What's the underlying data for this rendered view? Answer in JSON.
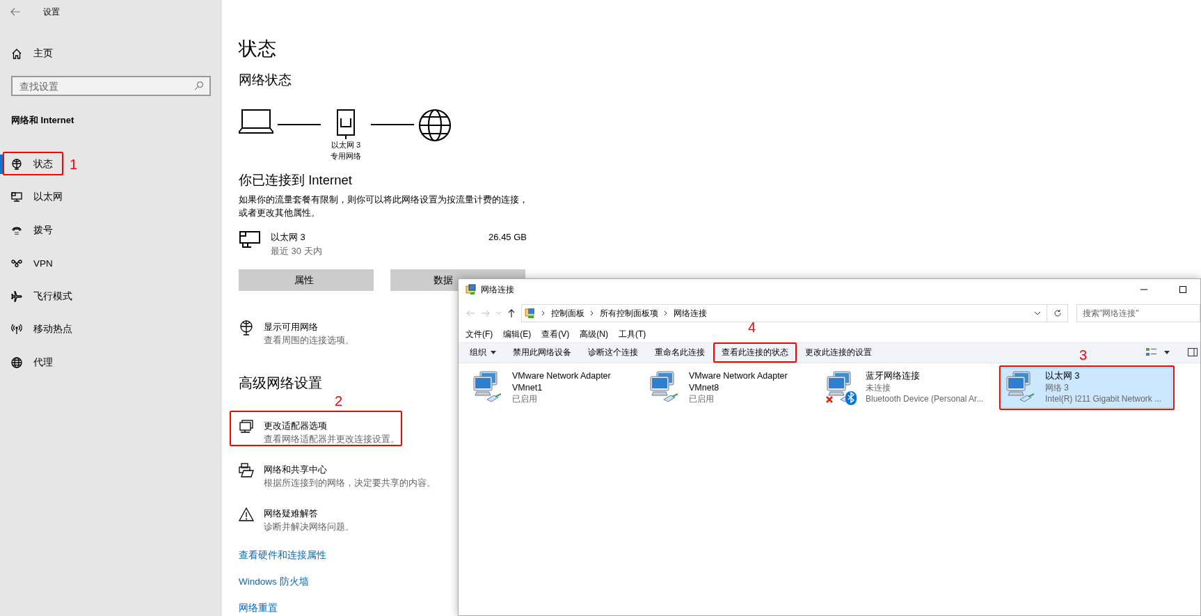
{
  "settings": {
    "title": "设置",
    "home": "主页",
    "search": {
      "placeholder": "查找设置"
    },
    "section": "网络和 Internet",
    "nav": [
      {
        "label": "状态",
        "selected": true,
        "annotation": "1"
      },
      {
        "label": "以太网",
        "selected": false
      },
      {
        "label": "拨号",
        "selected": false
      },
      {
        "label": "VPN",
        "selected": false
      },
      {
        "label": "飞行模式",
        "selected": false
      },
      {
        "label": "移动热点",
        "selected": false
      },
      {
        "label": "代理",
        "selected": false
      }
    ]
  },
  "page": {
    "title": "状态",
    "subtitle": "网络状态",
    "diagram": {
      "adapter": "以太网 3",
      "network": "专用网络"
    },
    "connected": "你已连接到 Internet",
    "description": "如果你的流量套餐有限制，则你可以将此网络设置为按流量计费的连接，或者更改其他属性。",
    "usage": {
      "name": "以太网 3",
      "period": "最近 30 天内",
      "amount": "26.45 GB"
    },
    "buttons": [
      "属性",
      "数据"
    ],
    "show_networks": {
      "title": "显示可用网络",
      "subtitle": "查看周围的连接选项。"
    },
    "advanced_heading": "高级网络设置",
    "options": [
      {
        "title": "更改适配器选项",
        "subtitle": "查看网络适配器并更改连接设置。",
        "annotation": "2"
      },
      {
        "title": "网络和共享中心",
        "subtitle": "根据所连接到的网络，决定要共享的内容。"
      },
      {
        "title": "网络疑难解答",
        "subtitle": "诊断并解决网络问题。"
      }
    ],
    "links": [
      "查看硬件和连接属性",
      "Windows 防火墙",
      "网络重置"
    ]
  },
  "explorer": {
    "title": "网络连接",
    "breadcrumbs": [
      "控制面板",
      "所有控制面板项",
      "网络连接"
    ],
    "search": {
      "placeholder": "搜索\"网络连接\""
    },
    "menu": [
      "文件(F)",
      "编辑(E)",
      "查看(V)",
      "高级(N)",
      "工具(T)"
    ],
    "commands": [
      {
        "label": "组织",
        "dropdown": true
      },
      {
        "label": "禁用此网络设备",
        "dropdown": false
      },
      {
        "label": "诊断这个连接",
        "dropdown": false
      },
      {
        "label": "重命名此连接",
        "dropdown": false
      },
      {
        "label": "查看此连接的状态",
        "dropdown": false,
        "annotation": "4"
      },
      {
        "label": "更改此连接的设置",
        "dropdown": false
      }
    ],
    "adapters": [
      {
        "kind": "ethernet",
        "name": "VMware Network Adapter VMnet1",
        "status": "已启用",
        "disconnected": false,
        "selected": false
      },
      {
        "kind": "ethernet",
        "name": "VMware Network Adapter VMnet8",
        "status": "已启用",
        "disconnected": false,
        "selected": false
      },
      {
        "kind": "bluetooth",
        "name": "蓝牙网络连接",
        "status": "未连接",
        "device": "Bluetooth Device (Personal Ar...",
        "disconnected": true,
        "selected": false
      },
      {
        "kind": "ethernet",
        "name": "以太网 3",
        "status": "网络 3",
        "device": "Intel(R) I211 Gigabit Network ...",
        "disconnected": false,
        "selected": true,
        "annotation": "3"
      }
    ]
  }
}
